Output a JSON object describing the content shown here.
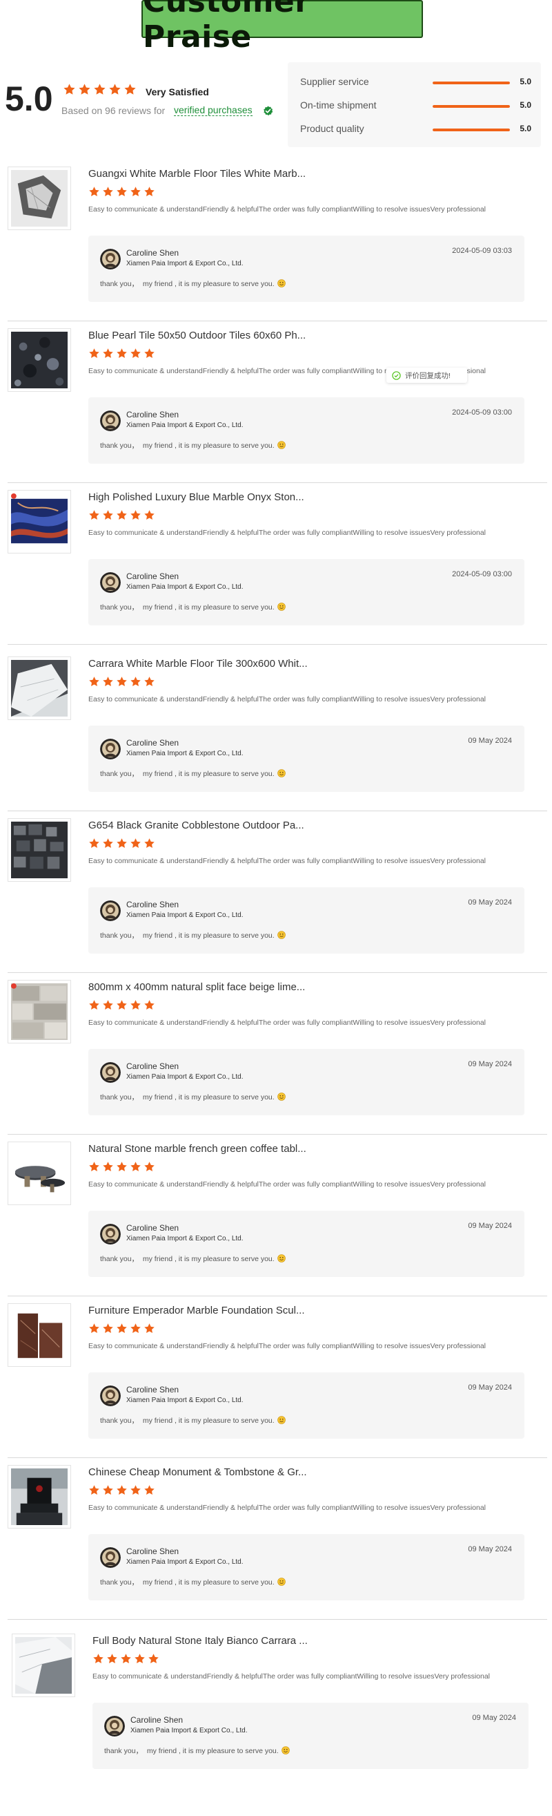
{
  "banner": {
    "title": "Customer Praise"
  },
  "summary": {
    "score": "5.0",
    "rating_text": "Very Satisfied",
    "based_on": "Based on 96 reviews for",
    "verified": "verified purchases",
    "stars": 5,
    "ratings": [
      {
        "label": "Supplier service",
        "value": "5.0",
        "fill": 1.0
      },
      {
        "label": "On-time shipment",
        "value": "5.0",
        "fill": 1.0
      },
      {
        "label": "Product quality",
        "value": "5.0",
        "fill": 1.0
      }
    ]
  },
  "colors": {
    "star": "#f06318",
    "accent": "#f06318",
    "verified": "#1f8f3a",
    "banner": "#6fc363"
  },
  "toast": {
    "text": "评价回复成功!",
    "icon": "check-circle-icon"
  },
  "reviews": [
    {
      "title": "Guangxi White Marble Floor Tiles White Marb...",
      "stars": 5,
      "comment": "Easy to communicate & understandFriendly & helpfulThe order was fully compliantWilling to resolve issuesVery professional",
      "reply_name": "Caroline Shen",
      "reply_company": "Xiamen Paia Import & Export Co., Ltd.",
      "reply_date": "2024-05-09 03:03",
      "reply_text": "thank you，  my friend , it is my pleasure to serve you.",
      "thumb": "white-marble"
    },
    {
      "title": "Blue Pearl Tile 50x50 Outdoor Tiles 60x60 Ph...",
      "stars": 5,
      "comment": "Easy to communicate & understandFriendly & helpfulThe order was fully compliantWilling to resolve issuesVery professional",
      "reply_name": "Caroline Shen",
      "reply_company": "Xiamen Paia Import & Export Co., Ltd.",
      "reply_date": "2024-05-09 03:00",
      "reply_text": "thank you，  my friend , it is my pleasure to serve you.",
      "thumb": "blue-pearl"
    },
    {
      "title": "High Polished Luxury Blue Marble Onyx Ston...",
      "stars": 5,
      "comment": "Easy to communicate & understandFriendly & helpfulThe order was fully compliantWilling to resolve issuesVery professional",
      "reply_name": "Caroline Shen",
      "reply_company": "Xiamen Paia Import & Export Co., Ltd.",
      "reply_date": "2024-05-09 03:00",
      "reply_text": "thank you，  my friend , it is my pleasure to serve you.",
      "thumb": "blue-onyx"
    },
    {
      "title": "Carrara White Marble Floor Tile 300x600 Whit...",
      "stars": 5,
      "comment": "Easy to communicate & understandFriendly & helpfulThe order was fully compliantWilling to resolve issuesVery professional",
      "reply_name": "Caroline Shen",
      "reply_company": "Xiamen Paia Import & Export Co., Ltd.",
      "reply_date": "09 May 2024",
      "reply_text": "thank you，  my friend , it is my pleasure to serve you.",
      "thumb": "carrara"
    },
    {
      "title": "G654 Black Granite Cobblestone Outdoor Pa...",
      "stars": 5,
      "comment": "Easy to communicate & understandFriendly & helpfulThe order was fully compliantWilling to resolve issuesVery professional",
      "reply_name": "Caroline Shen",
      "reply_company": "Xiamen Paia Import & Export Co., Ltd.",
      "reply_date": "09 May 2024",
      "reply_text": "thank you，  my friend , it is my pleasure to serve you.",
      "thumb": "cobblestone"
    },
    {
      "title": "800mm x 400mm natural split face beige lime...",
      "stars": 5,
      "comment": "Easy to communicate & understandFriendly & helpfulThe order was fully compliantWilling to resolve issuesVery professional",
      "reply_name": "Caroline Shen",
      "reply_company": "Xiamen Paia Import & Export Co., Ltd.",
      "reply_date": "09 May 2024",
      "reply_text": "thank you，  my friend , it is my pleasure to serve you.",
      "thumb": "limestone"
    },
    {
      "title": "Natural Stone marble french green coffee tabl...",
      "stars": 5,
      "comment": "Easy to communicate & understandFriendly & helpfulThe order was fully compliantWilling to resolve issuesVery professional",
      "reply_name": "Caroline Shen",
      "reply_company": "Xiamen Paia Import & Export Co., Ltd.",
      "reply_date": "09 May 2024",
      "reply_text": "thank you，  my friend , it is my pleasure to serve you.",
      "thumb": "coffee-table"
    },
    {
      "title": "Furniture Emperador Marble Foundation Scul...",
      "stars": 5,
      "comment": "Easy to communicate & understandFriendly & helpfulThe order was fully compliantWilling to resolve issuesVery professional",
      "reply_name": "Caroline Shen",
      "reply_company": "Xiamen Paia Import & Export Co., Ltd.",
      "reply_date": "09 May 2024",
      "reply_text": "thank you，  my friend , it is my pleasure to serve you.",
      "thumb": "emperador"
    },
    {
      "title": "Chinese Cheap Monument & Tombstone & Gr...",
      "stars": 5,
      "comment": "Easy to communicate & understandFriendly & helpfulThe order was fully compliantWilling to resolve issuesVery professional",
      "reply_name": "Caroline Shen",
      "reply_company": "Xiamen Paia Import & Export Co., Ltd.",
      "reply_date": "09 May 2024",
      "reply_text": "thank you，  my friend , it is my pleasure to serve you.",
      "thumb": "monument"
    },
    {
      "title": "Full Body Natural Stone Italy Bianco Carrara ...",
      "stars": 5,
      "comment": "Easy to communicate & understandFriendly & helpfulThe order was fully compliantWilling to resolve issuesVery professional",
      "reply_name": "Caroline Shen",
      "reply_company": "Xiamen Paia Import & Export Co., Ltd.",
      "reply_date": "09 May 2024",
      "reply_text": "thank you，  my friend , it is my pleasure to serve you.",
      "thumb": "bianco"
    }
  ]
}
